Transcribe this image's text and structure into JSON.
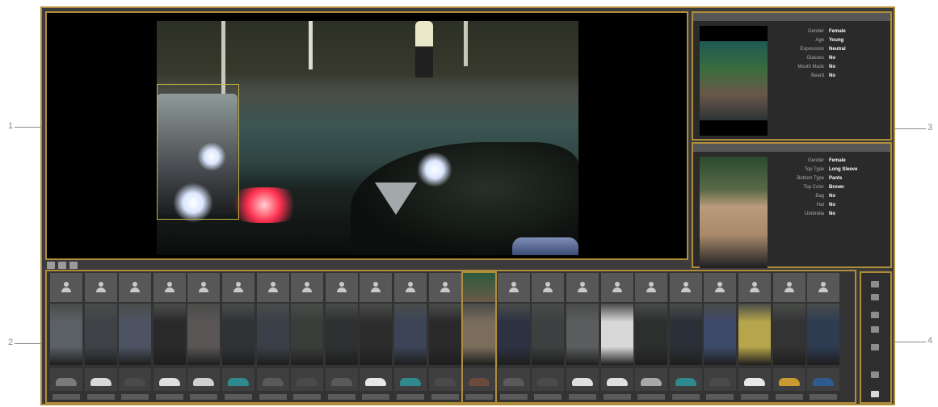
{
  "callouts": [
    "1",
    "2",
    "3",
    "4"
  ],
  "video": {
    "title": "",
    "timestamp": "",
    "overlay_text": "",
    "toolbar_icons": [
      "snapshot-icon",
      "record-icon",
      "zoom-icon"
    ]
  },
  "panels": [
    {
      "header": "",
      "attributes": [
        {
          "key": "Gender",
          "value": "Female"
        },
        {
          "key": "Age",
          "value": "Young"
        },
        {
          "key": "Expression",
          "value": "Neutral"
        },
        {
          "key": "Glasses",
          "value": "No"
        },
        {
          "key": "Mouth Mask",
          "value": "No"
        },
        {
          "key": "Beard",
          "value": "No"
        }
      ]
    },
    {
      "header": "",
      "attributes": [
        {
          "key": "Gender",
          "value": "Female"
        },
        {
          "key": "Top Type",
          "value": "Long Sleeve"
        },
        {
          "key": "Bottom Type",
          "value": "Pants"
        },
        {
          "key": "Top Color",
          "value": "Brown"
        },
        {
          "key": "Bag",
          "value": "No"
        },
        {
          "key": "Hat",
          "value": "No"
        },
        {
          "key": "Umbrella",
          "value": "No"
        }
      ]
    }
  ],
  "strip": {
    "count": 23,
    "selected_index": 12,
    "body_colors": [
      "#5b6066",
      "#3f4247",
      "#4d5362",
      "#2a2a2a",
      "#5a5656",
      "#303336",
      "#3b4048",
      "#3a3d3a",
      "#2e3032",
      "#2c2c2c",
      "#3c4558",
      "#2a2a2a",
      "#7a6d5c",
      "#2c3242",
      "#3d3f40",
      "#5b5d5e",
      "#d8d8d8",
      "#2c2f2e",
      "#2b3038",
      "#3e4a6a",
      "#b6a54a",
      "#333333",
      "#2e3c52"
    ],
    "vehicle_colors": [
      "#7a7a7a",
      "#d8d8d8",
      "#4a4a4a",
      "#e0e0e0",
      "#d0d0d0",
      "#2f8a90",
      "#5a5a5a",
      "#4a4a4a",
      "#5a5a5a",
      "#e8e8e8",
      "#2f8a90",
      "#4a4a4a",
      "#6a4a3a",
      "#5a5a5a",
      "#4a4a4a",
      "#e0e0e0",
      "#e0e0e0",
      "#a8a8a8",
      "#2f8a90",
      "#4a4a4a",
      "#e8e8e8",
      "#c89a30",
      "#2f5a90"
    ]
  },
  "side_controls": [
    "person-filter-icon",
    "vehicle-filter-icon",
    "all-icon",
    "sort-icon",
    "export-icon",
    "list-icon",
    "settings-icon"
  ]
}
